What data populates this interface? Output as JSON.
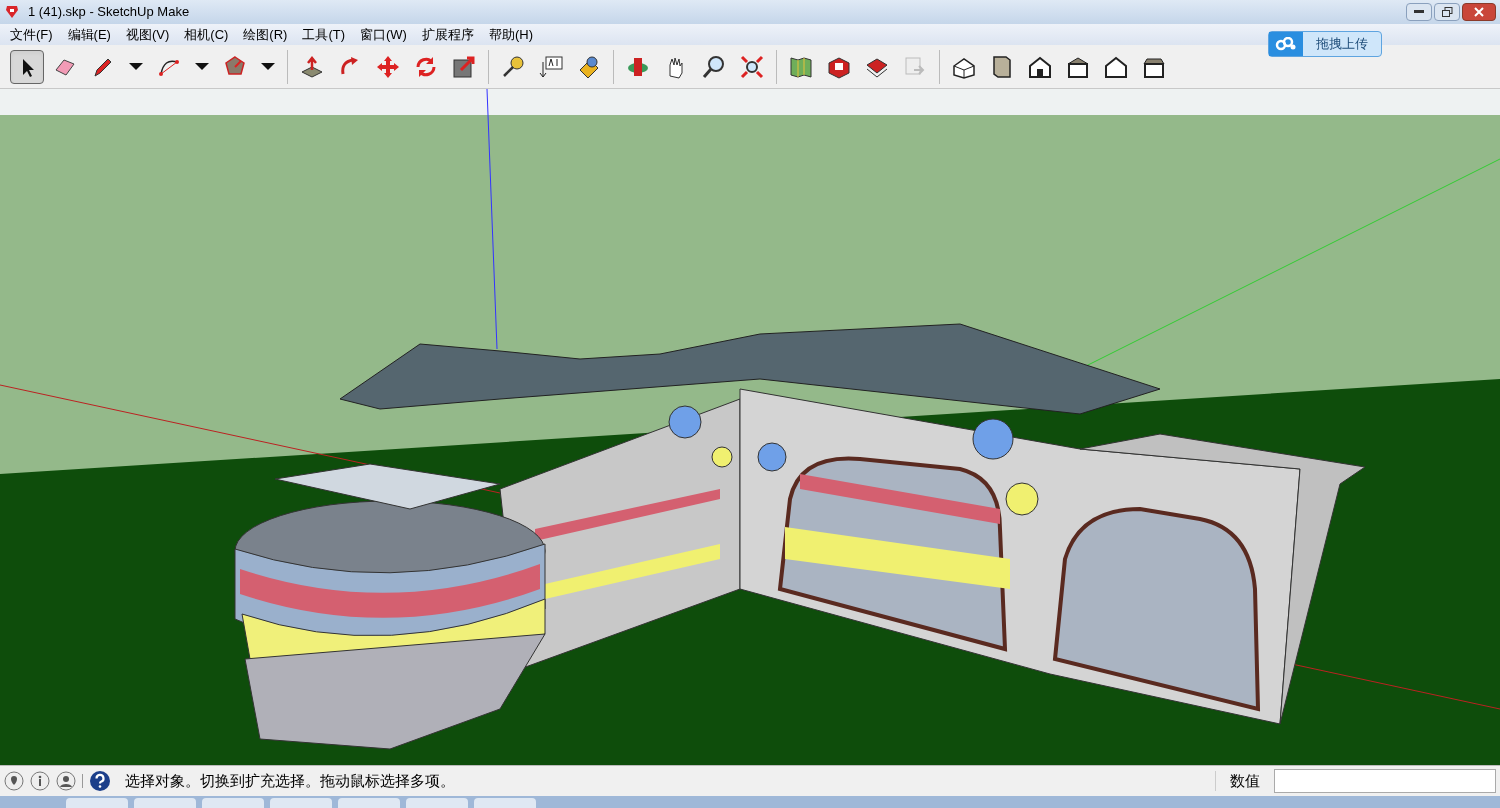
{
  "window": {
    "title": "1 (41).skp - SketchUp Make"
  },
  "menu": [
    "文件(F)",
    "编辑(E)",
    "视图(V)",
    "相机(C)",
    "绘图(R)",
    "工具(T)",
    "窗口(W)",
    "扩展程序",
    "帮助(H)"
  ],
  "upload_button": {
    "label": "拖拽上传"
  },
  "toolbar": [
    [
      {
        "kind": "select",
        "selected": true
      },
      {
        "kind": "eraser",
        "selected": false
      },
      {
        "kind": "pencil",
        "selected": false
      },
      {
        "kind": "caret",
        "selected": false
      },
      {
        "kind": "arc",
        "selected": false
      },
      {
        "kind": "caret",
        "selected": false
      },
      {
        "kind": "polygon",
        "selected": false
      },
      {
        "kind": "caret",
        "selected": false
      }
    ],
    [
      {
        "kind": "pushpull",
        "selected": false
      },
      {
        "kind": "followme",
        "selected": false
      },
      {
        "kind": "move",
        "selected": false
      },
      {
        "kind": "rotate",
        "selected": false
      },
      {
        "kind": "scale",
        "selected": false
      }
    ],
    [
      {
        "kind": "tape",
        "selected": false
      },
      {
        "kind": "text",
        "selected": false
      },
      {
        "kind": "paint",
        "selected": false
      }
    ],
    [
      {
        "kind": "orbit",
        "selected": false
      },
      {
        "kind": "pan",
        "selected": false
      },
      {
        "kind": "zoom",
        "selected": false
      },
      {
        "kind": "extents",
        "selected": false
      }
    ],
    [
      {
        "kind": "map",
        "selected": false
      },
      {
        "kind": "warehouse",
        "selected": false
      },
      {
        "kind": "extension",
        "selected": false
      },
      {
        "kind": "share",
        "selected": false
      }
    ],
    [
      {
        "kind": "iso",
        "selected": false
      },
      {
        "kind": "top",
        "selected": false
      },
      {
        "kind": "front",
        "selected": false
      },
      {
        "kind": "right",
        "selected": false
      },
      {
        "kind": "back",
        "selected": false
      },
      {
        "kind": "left",
        "selected": false
      }
    ]
  ],
  "status_bar": {
    "message": "选择对象。切换到扩充选择。拖动鼠标选择多项。",
    "measurement_label": "数值"
  }
}
